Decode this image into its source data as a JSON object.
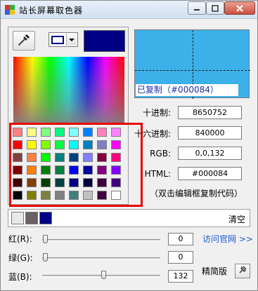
{
  "window": {
    "title": "站长屏幕取色器",
    "icons": {
      "app": "color-picker-app-icon",
      "minimize": "minimize-icon",
      "maximize": "maximize-icon",
      "close": "close-icon"
    }
  },
  "picker": {
    "eyedropper_icon": "eyedropper-icon",
    "current_color": "#000084"
  },
  "palette": {
    "colors": [
      "#ff8080",
      "#ffff80",
      "#80ff80",
      "#00ff80",
      "#80ffff",
      "#0080ff",
      "#ff80c0",
      "#ff80ff",
      "#ff0000",
      "#ffff00",
      "#80ff00",
      "#00ff40",
      "#00ffff",
      "#0080c0",
      "#8080c0",
      "#ff00ff",
      "#804040",
      "#ff8040",
      "#00ff00",
      "#008080",
      "#004080",
      "#8080ff",
      "#800040",
      "#ff0080",
      "#800000",
      "#ff8000",
      "#008000",
      "#008040",
      "#0000ff",
      "#0000a0",
      "#800080",
      "#8000ff",
      "#400000",
      "#804000",
      "#004000",
      "#004040",
      "#000080",
      "#000040",
      "#400040",
      "#400080",
      "#000000",
      "#808000",
      "#808040",
      "#808080",
      "#408080",
      "#c0c0c0",
      "#400040",
      "#ffffff"
    ]
  },
  "preview": {
    "background": "#3cb0e8",
    "copied_text": "已复制（#000084）"
  },
  "values": {
    "decimal_label": "十进制:",
    "decimal_value": "8650752",
    "hex_label": "十六进制:",
    "hex_value": "840000",
    "rgb_label": "RGB:",
    "rgb_value": "0,0,132",
    "html_label": "HTML:",
    "html_value": "#000084",
    "hint": "（双击编辑框复制代码）"
  },
  "history": {
    "swatches": [
      "#e8e8e8",
      "#6a6066",
      "#000084"
    ],
    "clear_label": "清空"
  },
  "sliders": {
    "red": {
      "label": "红(R):",
      "value": "0",
      "fraction": 0.0
    },
    "green": {
      "label": "绿(G):",
      "value": "0",
      "fraction": 0.0
    },
    "blue": {
      "label": "蓝(B):",
      "value": "132",
      "fraction": 0.52
    }
  },
  "links": {
    "visit_site": "访问官网 >>",
    "lite_mode": "精简版",
    "pin_icon": "pin-icon"
  }
}
